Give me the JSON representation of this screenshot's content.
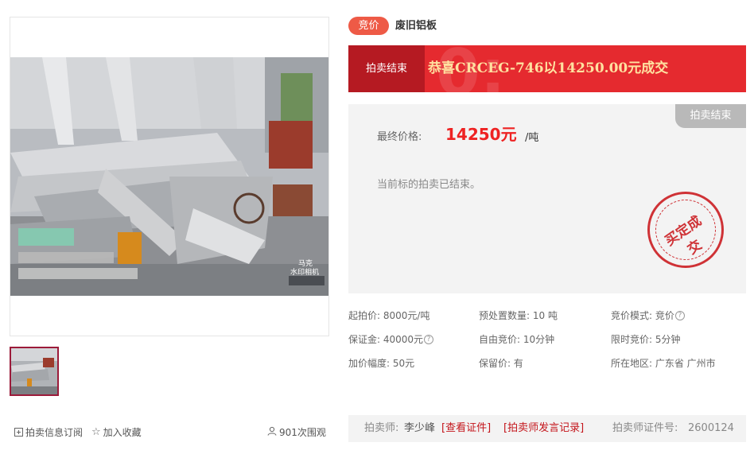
{
  "gallery": {
    "watermark_line1": "马克",
    "watermark_line2": "水印相机"
  },
  "left_actions": {
    "subscribe_label": "拍卖信息订阅",
    "favorite_label": "加入收藏",
    "views_label": "901次围观"
  },
  "header": {
    "tag": "竞价",
    "title": "废旧铝板"
  },
  "banner": {
    "status": "拍卖结束",
    "message": "恭喜CRCEG-746以14250.00元成交"
  },
  "result": {
    "corner_label": "拍卖结束",
    "final_price_label": "最终价格:",
    "final_price": "14250元",
    "final_unit": "/吨",
    "ended_text": "当前标的拍卖已结束。",
    "stamp_text": "买定成交"
  },
  "info": {
    "start_price": "起拍价: 8000元/吨",
    "quantity": "预处置数量: 10 吨",
    "bid_mode": "竞价模式: 竞价",
    "deposit": "保证金: 40000元",
    "free_bid": "自由竞价: 10分钟",
    "limited_bid": "限时竞价: 5分钟",
    "increment": "加价幅度: 50元",
    "reserve": "保留价: 有",
    "location": "所在地区: 广东省 广州市"
  },
  "auctioneer": {
    "label": "拍卖师:",
    "name": "李少峰",
    "cert_link": "[查看证件]",
    "record_link": "[拍卖师发言记录]",
    "cert_no_label": "拍卖师证件号:",
    "cert_no": "2600124"
  },
  "colors": {
    "accent_red": "#e52a2f",
    "tag_orange": "#ee5a46",
    "link_red": "#c4161c",
    "panel_gray": "#f3f3f3"
  }
}
